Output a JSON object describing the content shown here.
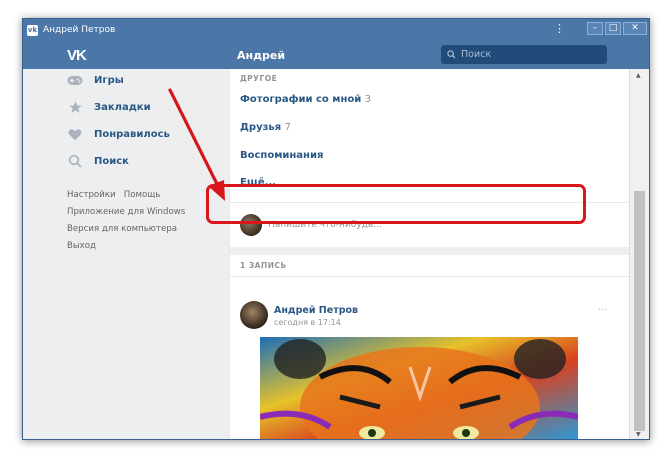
{
  "window": {
    "title": "Андрей Петров",
    "menu_glyph": "⋮"
  },
  "header": {
    "logo": "VK",
    "title": "Андрей",
    "search_placeholder": "Поиск"
  },
  "sidebar": {
    "items": [
      {
        "label": "Игры",
        "icon": "gamepad-icon"
      },
      {
        "label": "Закладки",
        "icon": "star-icon"
      },
      {
        "label": "Понравилось",
        "icon": "heart-icon"
      },
      {
        "label": "Поиск",
        "icon": "search-icon"
      }
    ],
    "links": {
      "settings": "Настройки",
      "help": "Помощь",
      "windows_app": "Приложение для Windows",
      "desktop_version": "Версия для компьютера",
      "logout": "Выход"
    }
  },
  "main": {
    "other_header": "ДРУГОЕ",
    "items": [
      {
        "label": "Фотографии со мной",
        "count": "3"
      },
      {
        "label": "Друзья",
        "count": "7"
      },
      {
        "label": "Воспоминания",
        "count": ""
      },
      {
        "label": "Ещё...",
        "count": ""
      }
    ],
    "composer_placeholder": "Напишите что-нибудь...",
    "posts_count_header": "1 ЗАПИСЬ",
    "post": {
      "author": "Андрей Петров",
      "time": "сегодня в 17:14",
      "more": "···"
    }
  },
  "colors": {
    "brand": "#4a76a8",
    "link": "#2a5885",
    "highlight": "#d9171a"
  }
}
